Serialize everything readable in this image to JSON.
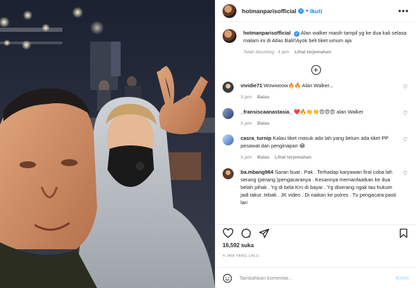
{
  "post": {
    "username": "hotmanparisofficial",
    "follow_label": "Ikuti",
    "more_label": "•••"
  },
  "caption": {
    "username": "hotmanparisofficial",
    "text": "Alan walker masih tampil yg ke dua kali selasa malam ini di Atlas Bali!!Ayok beli tiket umum aja",
    "edited": "Telah disunting · 4 jam",
    "translate": "Lihat terjemahan"
  },
  "load_more": "+",
  "comments": [
    {
      "username": "vividie71",
      "text": "Wowwoow🔥🔥 Alan Walker...",
      "time": "3 jam",
      "reply": "Balas",
      "translate": ""
    },
    {
      "username": "_fransiscaanastasia_",
      "text": "❤️🔥👏👏😍😍😍 alan Walker",
      "time": "3 jam",
      "reply": "Balas",
      "translate": ""
    },
    {
      "username": "casra_turnip",
      "text": "Kalau tiket masuk ada lah yang belum ada tiket PP pesawat dan penginapan 😂",
      "time": "3 jam",
      "reply": "Balas",
      "translate": "Lihat terjemahan"
    },
    {
      "username": "ba.mbang984",
      "text": "Saran buat . Pak . Terhadap karyawan firal coba lah serang (perang )pengacaranya . Kesannya memanfaatkan ke dua belah pihak . Yg di bela Krn di bayar . Yg diserang ngak tau hukum jadi takut .tebak . JK video . Di naikan ke polres . Tu pengacara pasti lari",
      "time": "",
      "reply": "",
      "translate": ""
    }
  ],
  "likes": "16,592 suka",
  "posted": "4 JAM YANG LALU",
  "add_comment": {
    "placeholder": "Tambahkan komentar...",
    "post_label": "Kirim"
  },
  "colors": {
    "accent": "#0095f6",
    "verified": "#3897f0",
    "muted": "#8e8e8e",
    "border": "#efefef"
  }
}
